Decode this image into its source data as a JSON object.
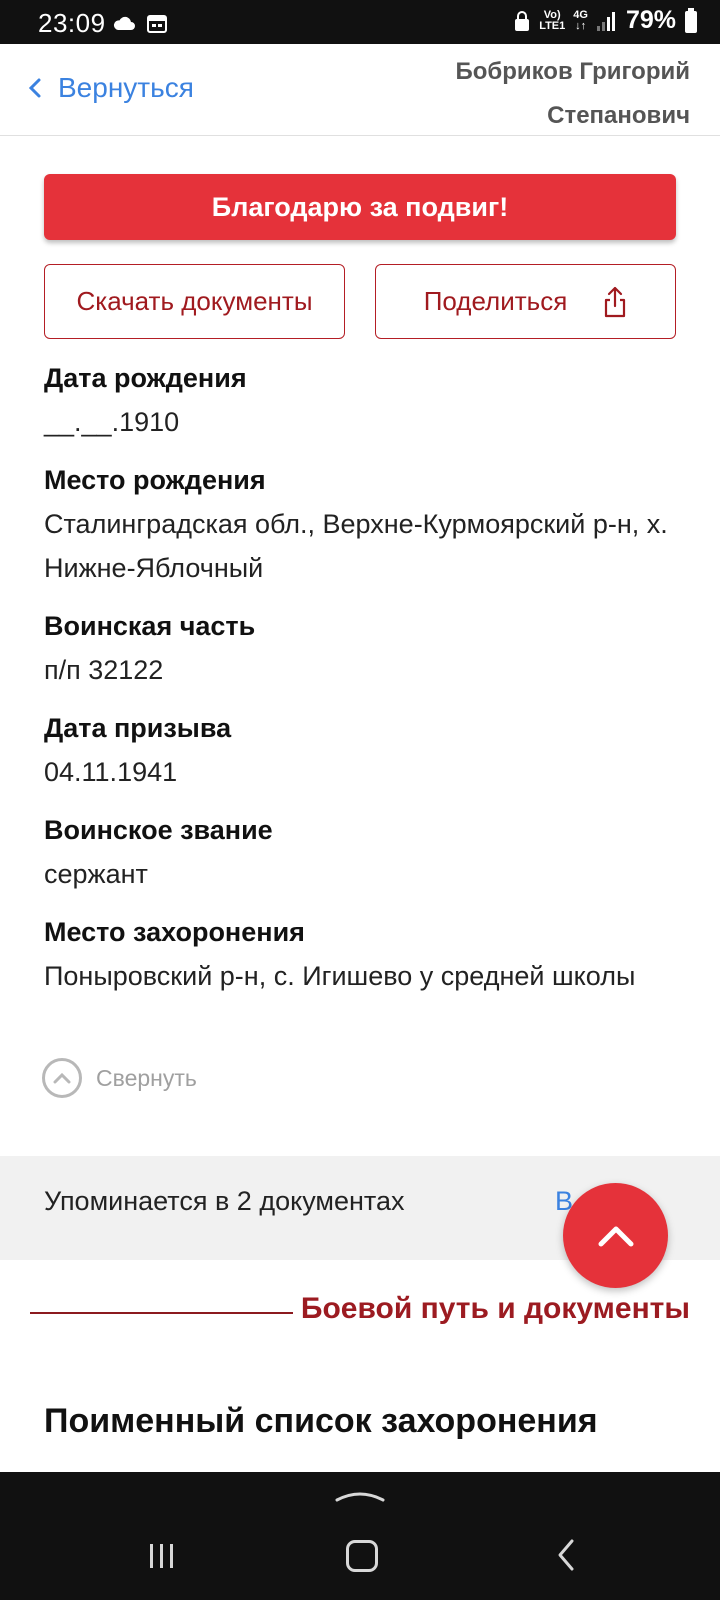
{
  "status_bar": {
    "time": "23:09",
    "network_top": "Vo)",
    "network_bottom": "LTE1",
    "signal_type": "4G",
    "battery": "79%"
  },
  "header": {
    "back_label": "Вернуться",
    "person_name": "Бобриков Григорий Степанович"
  },
  "actions": {
    "thanks_label": "Благодарю за подвиг!",
    "download_label": "Скачать документы",
    "share_label": "Поделиться"
  },
  "fields": [
    {
      "label": "Дата рождения",
      "value": "__.__.1910"
    },
    {
      "label": "Место рождения",
      "value": "Сталинградская обл., Верхне-Курмоярский р-н, х. Нижне-Яблочный"
    },
    {
      "label": "Воинская часть",
      "value": "п/п 32122"
    },
    {
      "label": "Дата призыва",
      "value": "04.11.1941"
    },
    {
      "label": "Воинское звание",
      "value": "сержант"
    },
    {
      "label": "Место захоронения",
      "value": "Поныровский р-н, с. Игишево у средней школы"
    }
  ],
  "collapse_label": "Свернуть",
  "mentions": {
    "text": "Упоминается в 2 документах",
    "link_partial": "В"
  },
  "section_title": "Боевой путь и документы",
  "list_title": "Поименный список захоронения",
  "colors": {
    "accent_red": "#e5323a",
    "dark_red": "#9c1b21",
    "link_blue": "#3b82e0"
  },
  "icons": [
    "cloud-icon",
    "calendar-icon",
    "lock-icon",
    "signal-icon",
    "battery-icon",
    "chevron-left-icon",
    "share-icon",
    "chevron-up-icon"
  ]
}
